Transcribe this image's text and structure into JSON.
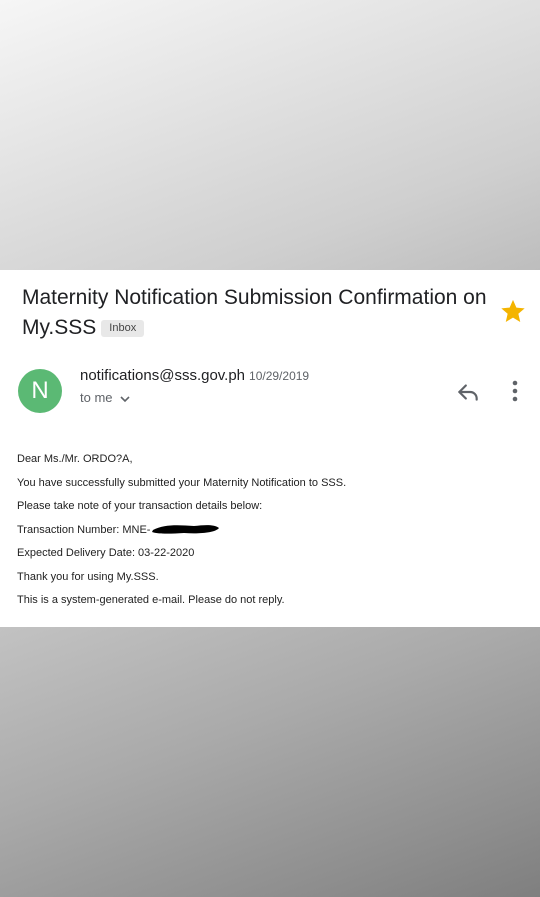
{
  "email": {
    "subject": "Maternity Notification Submission Confirmation on My.SSS",
    "label_chip": "Inbox",
    "starred": true,
    "sender": {
      "avatar_letter": "N",
      "address": "notifications@sss.gov.ph",
      "date": "10/29/2019",
      "recipient": "to me"
    },
    "body": {
      "greeting": "Dear Ms./Mr. ORDO?A,",
      "line1": "You have successfully submitted your Maternity Notification to SSS.",
      "line2": "Please take note of your transaction details below:",
      "transaction_label": "Transaction Number: MNE-",
      "delivery": "Expected Delivery Date: 03-22-2020",
      "thanks": "Thank you for using My.SSS.",
      "footer": "This is a system-generated e-mail. Please do not reply."
    }
  },
  "colors": {
    "avatar": "#5bb974",
    "star": "#f4b400",
    "text": "#202124",
    "muted": "#5f6368"
  },
  "icons": [
    "star-icon",
    "reply-icon",
    "more-vert-icon",
    "chevron-down-icon"
  ]
}
